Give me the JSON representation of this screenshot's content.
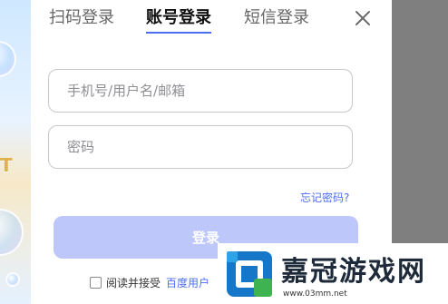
{
  "tabs": [
    {
      "label": "扫码登录"
    },
    {
      "label": "账号登录"
    },
    {
      "label": "短信登录"
    }
  ],
  "form": {
    "username_placeholder": "手机号/用户名/邮箱",
    "password_placeholder": "密码",
    "forgot_label": "忘记密码?",
    "login_label": "登录"
  },
  "agreement": {
    "prefix": "阅读并接受",
    "link": "百度用户"
  },
  "watermark": {
    "title": "嘉冠游戏网",
    "url": "www.03mm.net"
  },
  "background": {
    "partial_text": "T"
  },
  "colors": {
    "accent": "#4e6ef2",
    "login_button": "#bdc7fa",
    "overlay": "#7f7f80"
  }
}
